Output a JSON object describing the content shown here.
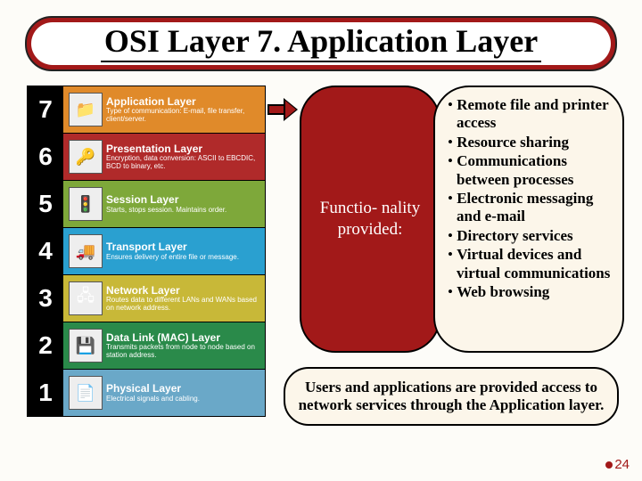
{
  "title": "OSI Layer 7. Application Layer",
  "layers": [
    {
      "num": "7",
      "name": "Application Layer",
      "desc": "Type of communication: E-mail, file transfer, client/server.",
      "bg": "bg7",
      "icon": "folder-icon",
      "glyph": "📁"
    },
    {
      "num": "6",
      "name": "Presentation Layer",
      "desc": "Encryption, data conversion: ASCII to EBCDIC, BCD to binary, etc.",
      "bg": "bg6",
      "icon": "key-icon",
      "glyph": "🔑"
    },
    {
      "num": "5",
      "name": "Session Layer",
      "desc": "Starts, stops session. Maintains order.",
      "bg": "bg5",
      "icon": "traffic-light-icon",
      "glyph": "🚦"
    },
    {
      "num": "4",
      "name": "Transport Layer",
      "desc": "Ensures delivery of entire file or message.",
      "bg": "bg4",
      "icon": "truck-icon",
      "glyph": "🚚"
    },
    {
      "num": "3",
      "name": "Network Layer",
      "desc": "Routes data to different LANs and WANs based on network address.",
      "bg": "bg3",
      "icon": "router-icon",
      "glyph": "🖧"
    },
    {
      "num": "2",
      "name": "Data Link (MAC) Layer",
      "desc": "Transmits packets from node to node based on station address.",
      "bg": "bg2",
      "icon": "nic-icon",
      "glyph": "💾"
    },
    {
      "num": "1",
      "name": "Physical Layer",
      "desc": "Electrical signals and cabling.",
      "bg": "bg1",
      "icon": "page-icon",
      "glyph": "📄"
    }
  ],
  "functionality_label": "Functio-\nnality provided:",
  "bullets": [
    "Remote file and printer access",
    "Resource sharing",
    "Communications between processes",
    "Electronic messaging and e-mail",
    "Directory services",
    "Virtual devices and virtual communications",
    "Web browsing"
  ],
  "summary": "Users and applications are provided access to network services through the Application  layer.",
  "page_number": "24"
}
